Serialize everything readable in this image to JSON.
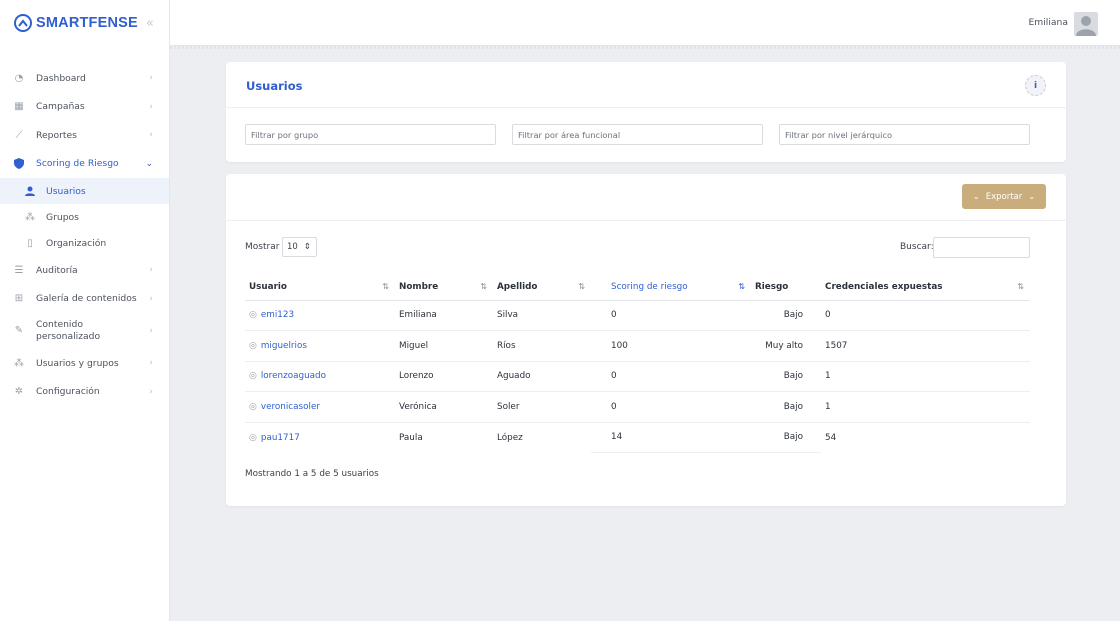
{
  "brand": {
    "name": "SMARTFENSE",
    "collapse_icon": "double-chevron-left-icon",
    "color": "#2f5fd0"
  },
  "topbar": {
    "user_name": "Emiliana",
    "avatar_icon": "user-avatar-icon"
  },
  "sidebar": {
    "items": [
      {
        "label": "Dashboard",
        "icon": "gauge-icon"
      },
      {
        "label": "Campañas",
        "icon": "calendar-icon"
      },
      {
        "label": "Reportes",
        "icon": "line-chart-icon"
      },
      {
        "label": "Scoring de Riesgo",
        "icon": "shield-icon",
        "expanded": true,
        "children": [
          {
            "label": "Usuarios",
            "icon": "user-icon",
            "active": true
          },
          {
            "label": "Grupos",
            "icon": "group-icon"
          },
          {
            "label": "Organización",
            "icon": "building-icon"
          }
        ]
      },
      {
        "label": "Auditoría",
        "icon": "list-icon"
      },
      {
        "label": "Galería de contenidos",
        "icon": "grid-icon"
      },
      {
        "label": "Contenido personalizado",
        "icon": "edit-icon"
      },
      {
        "label": "Usuarios y grupos",
        "icon": "users-icon"
      },
      {
        "label": "Configuración",
        "icon": "gear-icon"
      }
    ]
  },
  "filters_card": {
    "title": "Usuarios",
    "info_label": "i",
    "filters": [
      {
        "placeholder": "Filtrar por grupo"
      },
      {
        "placeholder": "Filtrar por área funcional"
      },
      {
        "placeholder": "Filtrar por nivel jerárquico"
      }
    ]
  },
  "table_card": {
    "export_label": "Exportar",
    "export_color": "#c9ad7c",
    "show_label": "Mostrar",
    "page_size": "10",
    "search_label": "Buscar:",
    "columns": [
      "Usuario",
      "Nombre",
      "Apellido",
      "Scoring de riesgo",
      "Riesgo",
      "Credenciales expuestas"
    ],
    "rows": [
      {
        "usuario": "emi123",
        "nombre": "Emiliana",
        "apellido": "Silva",
        "scoring": "0",
        "riesgo": "Bajo",
        "credenciales": "0"
      },
      {
        "usuario": "miguelrios",
        "nombre": "Miguel",
        "apellido": "Ríos",
        "scoring": "100",
        "riesgo": "Muy alto",
        "credenciales": "1507"
      },
      {
        "usuario": "lorenzoaguado",
        "nombre": "Lorenzo",
        "apellido": "Aguado",
        "scoring": "0",
        "riesgo": "Bajo",
        "credenciales": "1"
      },
      {
        "usuario": "veronicasoler",
        "nombre": "Verónica",
        "apellido": "Soler",
        "scoring": "0",
        "riesgo": "Bajo",
        "credenciales": "1"
      },
      {
        "usuario": "pau1717",
        "nombre": "Paula",
        "apellido": "López",
        "scoring": "14",
        "riesgo": "Bajo",
        "credenciales": "54"
      }
    ],
    "footer": "Mostrando 1 a 5 de 5 usuarios"
  }
}
